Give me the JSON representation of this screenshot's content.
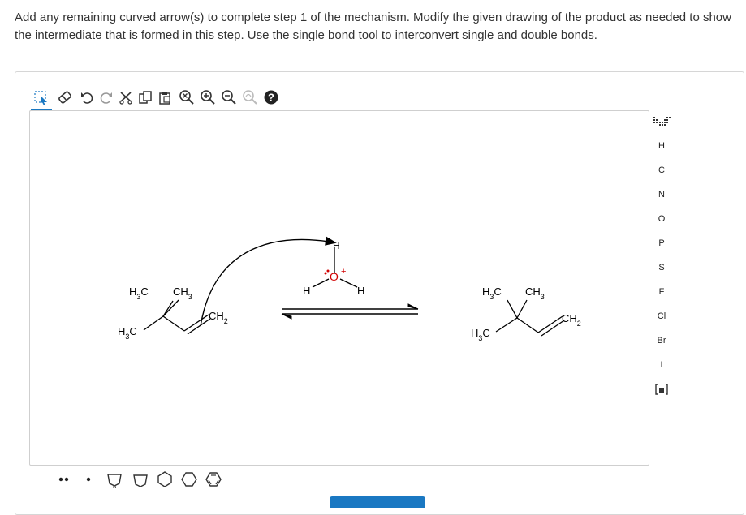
{
  "question": {
    "text": "Add any remaining curved arrow(s) to complete step 1 of the mechanism. Modify the given drawing of the product as needed to show the intermediate that is formed in this step. Use the single bond tool to interconvert single and double bonds."
  },
  "toolbar_top": {
    "icons": [
      "select-lasso-icon",
      "erase-icon",
      "undo-icon",
      "redo-icon",
      "cut-icon",
      "copy-icon",
      "paste-icon",
      "zoom-reset-icon",
      "zoom-in-icon",
      "zoom-out-icon",
      "zoom-fit-icon",
      "help-icon"
    ],
    "help_label": "?"
  },
  "toolbar_left": {
    "icons": [
      "single-bond-icon",
      "double-bond-icon",
      "triple-bond-icon",
      "wedge-bond-icon",
      "hash-bond-icon",
      "wavy-bond-icon",
      "chain-icon",
      "positive-charge-icon",
      "negative-charge-icon",
      "add-lone-pair-plus-icon",
      "add-lone-pair-arrow-icon",
      "remove-lone-pair-icon",
      "curved-arrow-pair-icon",
      "curved-arrow-single-icon"
    ]
  },
  "elements": [
    "H",
    "C",
    "N",
    "O",
    "P",
    "S",
    "F",
    "Cl",
    "Br",
    "I"
  ],
  "canvas": {
    "reactant": {
      "labels": [
        "H3C",
        "CH3",
        "CH2",
        "H3C"
      ]
    },
    "reagent": {
      "h_left": "H",
      "h_right": "H",
      "h_top": "H",
      "oxygen": "O",
      "charge": "+"
    },
    "product": {
      "labels": [
        "H3C",
        "CH3",
        "CH2",
        "H3C"
      ]
    }
  },
  "bottom_tools": {
    "icons": [
      "lone-pair-icon",
      "radical-icon",
      "pyrrole-ring-icon",
      "pentagon-ring-icon",
      "hexagon-ring-icon",
      "cyclohexane-ring-icon",
      "benzene-ring-icon"
    ]
  },
  "colors": {
    "accent": "#1a78c2",
    "oxygen": "#d10000",
    "arrow": "#000000"
  }
}
